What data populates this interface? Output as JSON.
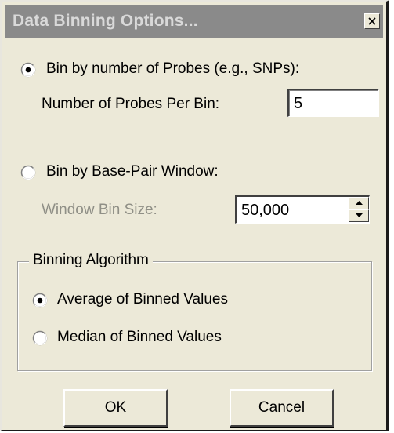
{
  "dialog": {
    "title": "Data Binning Options...",
    "close_icon": "close-icon"
  },
  "probes_option": {
    "label": "Bin by number of Probes (e.g., SNPs):",
    "selected": true,
    "field_label": "Number of Probes Per Bin:",
    "field_value": "5"
  },
  "window_option": {
    "label": "Bin by Base-Pair Window:",
    "selected": false,
    "field_label": "Window Bin Size:",
    "field_value": "50,000",
    "enabled": false
  },
  "algorithm": {
    "legend": "Binning Algorithm",
    "options": [
      {
        "label": "Average of Binned Values",
        "selected": true
      },
      {
        "label": "Median of Binned Values",
        "selected": false
      }
    ]
  },
  "buttons": {
    "ok": "OK",
    "cancel": "Cancel"
  }
}
